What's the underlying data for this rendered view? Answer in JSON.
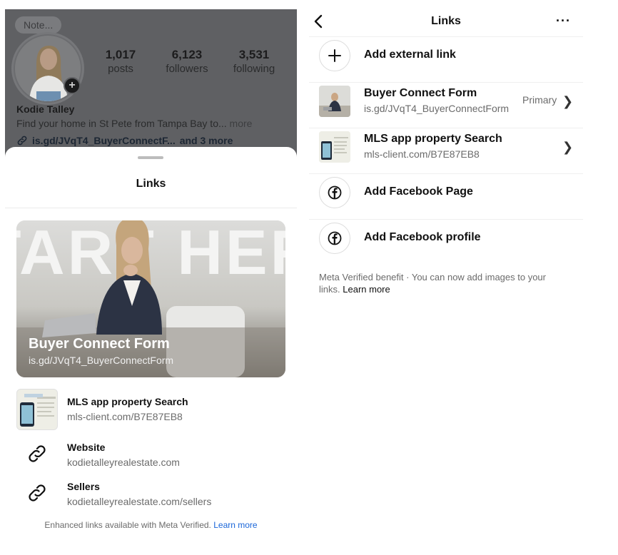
{
  "profile": {
    "note": "Note...",
    "name": "Kodie Talley",
    "bio": "Find your home in St Pete from Tampa Bay to...",
    "bio_more": "more",
    "link_text": "is.gd/JVqT4_BuyerConnectF...",
    "link_extra": "and 3 more",
    "stats": [
      {
        "value": "1,017",
        "label": "posts"
      },
      {
        "value": "6,123",
        "label": "followers"
      },
      {
        "value": "3,531",
        "label": "following"
      }
    ]
  },
  "sheet": {
    "title": "Links",
    "hero": {
      "banner_text": "START HERE",
      "title": "Buyer Connect Form",
      "url": "is.gd/JVqT4_BuyerConnectForm"
    },
    "links": [
      {
        "title": "MLS app property Search",
        "url": "mls-client.com/B7E87EB8",
        "icon": "mls-thumbnail"
      },
      {
        "title": "Website",
        "url": "kodietalleyrealestate.com",
        "icon": "link-icon"
      },
      {
        "title": "Sellers",
        "url": "kodietalleyrealestate.com/sellers",
        "icon": "link-icon"
      }
    ],
    "footer_text": "Enhanced links available with Meta Verified.",
    "footer_link": "Learn more"
  },
  "links_page": {
    "title": "Links",
    "more_icon": "···",
    "add_external": "Add external link",
    "items": [
      {
        "title": "Buyer Connect Form",
        "url": "is.gd/JVqT4_BuyerConnectForm",
        "badge": "Primary"
      },
      {
        "title": "MLS app property Search",
        "url": "mls-client.com/B7E87EB8",
        "badge": ""
      }
    ],
    "add_facebook_page": "Add Facebook Page",
    "add_facebook_profile": "Add Facebook profile",
    "footnote_strong": "Meta Verified benefit",
    "footnote_text": " · You can now add images to your links.",
    "footnote_link": "Learn more"
  },
  "colors": {
    "accent_link": "#1a66d9",
    "overlay": "#5f6063",
    "divider": "#efefef"
  }
}
